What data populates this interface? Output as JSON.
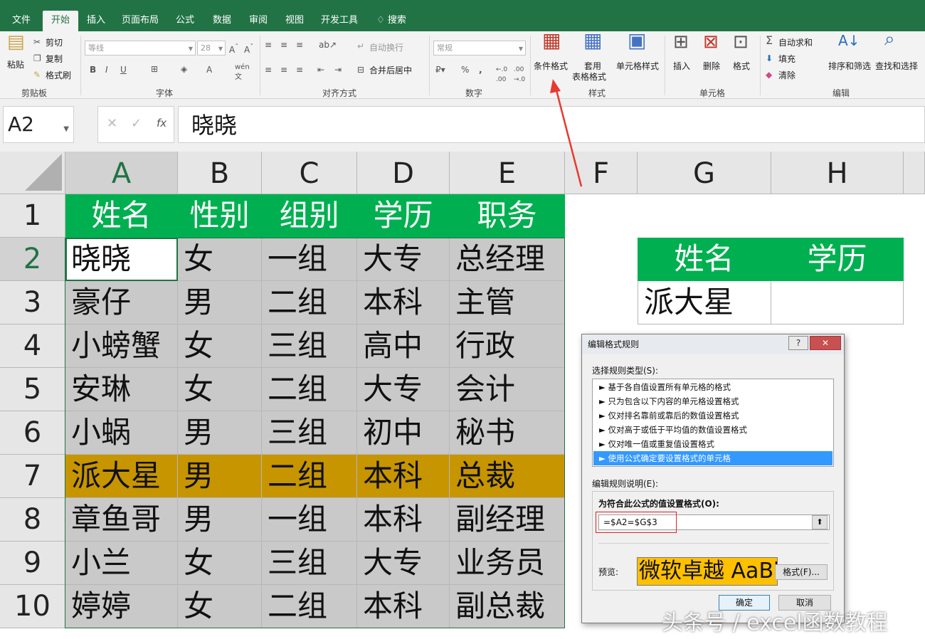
{
  "tabs": [
    "文件",
    "开始",
    "插入",
    "页面布局",
    "公式",
    "数据",
    "审阅",
    "视图",
    "开发工具"
  ],
  "tell_me": "搜索",
  "clipboard": {
    "paste": "粘贴",
    "cut": "剪切",
    "copy": "复制",
    "format_painter": "格式刷",
    "group": "剪贴板"
  },
  "font": {
    "name": "等线",
    "size": "28",
    "group": "字体"
  },
  "alignment": {
    "wrap": "自动换行",
    "merge": "合并后居中",
    "group": "对齐方式"
  },
  "number": {
    "format": "常规",
    "group": "数字"
  },
  "styles": {
    "conditional_1": "条件格式",
    "format_table_1": "套用",
    "format_table_2": "表格格式",
    "cell_styles": "单元格样式",
    "group": "样式"
  },
  "cells": {
    "insert": "插入",
    "delete": "删除",
    "format": "格式",
    "group": "单元格"
  },
  "editing": {
    "autosum": "自动求和",
    "fill": "填充",
    "clear": "清除",
    "sort": "排序和筛选",
    "find": "查找和选择",
    "group": "编辑"
  },
  "namebox": "A2",
  "formula": "晓晓",
  "columns": [
    "A",
    "B",
    "C",
    "D",
    "E",
    "F",
    "G",
    "H"
  ],
  "rows": [
    "1",
    "2",
    "3",
    "4",
    "5",
    "6",
    "7",
    "8",
    "9",
    "10"
  ],
  "table": {
    "header": [
      "姓名",
      "性别",
      "组别",
      "学历",
      "职务"
    ],
    "rows": [
      [
        "晓晓",
        "女",
        "一组",
        "大专",
        "总经理"
      ],
      [
        "豪仔",
        "男",
        "二组",
        "本科",
        "主管"
      ],
      [
        "小螃蟹",
        "女",
        "三组",
        "高中",
        "行政"
      ],
      [
        "安琳",
        "女",
        "二组",
        "大专",
        "会计"
      ],
      [
        "小蜗",
        "男",
        "三组",
        "初中",
        "秘书"
      ],
      [
        "派大星",
        "男",
        "二组",
        "本科",
        "总裁"
      ],
      [
        "章鱼哥",
        "男",
        "一组",
        "本科",
        "副经理"
      ],
      [
        "小兰",
        "女",
        "三组",
        "大专",
        "业务员"
      ],
      [
        "婷婷",
        "女",
        "二组",
        "本科",
        "副总裁"
      ]
    ]
  },
  "lookup": {
    "header": [
      "姓名",
      "学历"
    ],
    "name": "派大星",
    "edu": ""
  },
  "dialog": {
    "title": "编辑格式规则",
    "help": "?",
    "close": "✕",
    "select_type": "选择规则类型(S):",
    "rule_types": [
      "► 基于各自值设置所有单元格的格式",
      "► 只为包含以下内容的单元格设置格式",
      "► 仅对排名靠前或靠后的数值设置格式",
      "► 仅对高于或低于平均值的数值设置格式",
      "► 仅对唯一值或重复值设置格式",
      "► 使用公式确定要设置格式的单元格"
    ],
    "edit_desc": "编辑规则说明(E):",
    "formula_label": "为符合此公式的值设置格式(O):",
    "formula": "=$A2=$G$3",
    "preview_label": "预览:",
    "preview_text": "微软卓越  AaBbCc",
    "format_btn": "格式(F)...",
    "ok": "确定",
    "cancel": "取消"
  },
  "watermark": "头条号 / excel函数教程",
  "colors": {
    "excel_green": "#217346",
    "header_green": "#00b050",
    "gray_fill": "#c9c9c9",
    "highlight": "#c79500",
    "preview_fill": "#ffc000",
    "arrow": "#e8392f"
  }
}
